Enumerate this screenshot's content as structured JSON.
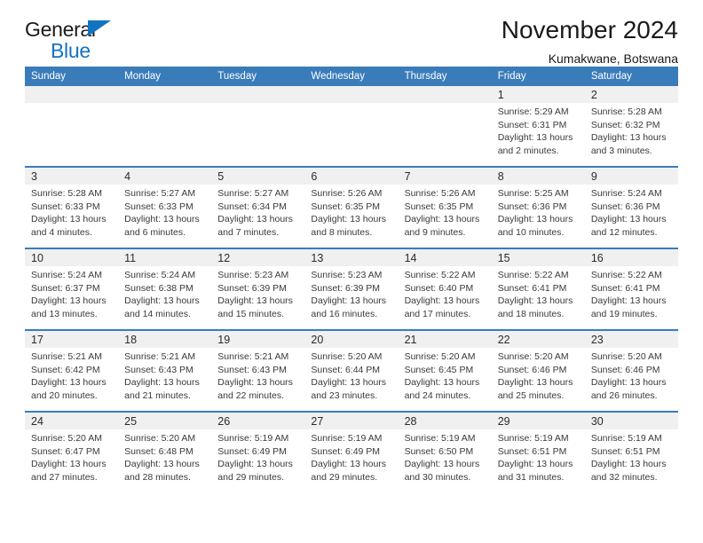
{
  "brand": {
    "name_top": "General",
    "name_bottom": "Blue",
    "triangle_color": "#1273c1"
  },
  "header": {
    "title": "November 2024",
    "subtitle": "Kumakwane, Botswana"
  },
  "theme": {
    "header_blue": "#3a7cba",
    "day_band_gray": "#f0f0f0",
    "text_dark": "#1a1a1a",
    "text_body": "#3a3a3a"
  },
  "calendar": {
    "weekdays": [
      "Sunday",
      "Monday",
      "Tuesday",
      "Wednesday",
      "Thursday",
      "Friday",
      "Saturday"
    ],
    "weeks": [
      [
        {
          "day": "",
          "lines": []
        },
        {
          "day": "",
          "lines": []
        },
        {
          "day": "",
          "lines": []
        },
        {
          "day": "",
          "lines": []
        },
        {
          "day": "",
          "lines": []
        },
        {
          "day": "1",
          "lines": [
            "Sunrise: 5:29 AM",
            "Sunset: 6:31 PM",
            "Daylight: 13 hours",
            "and 2 minutes."
          ]
        },
        {
          "day": "2",
          "lines": [
            "Sunrise: 5:28 AM",
            "Sunset: 6:32 PM",
            "Daylight: 13 hours",
            "and 3 minutes."
          ]
        }
      ],
      [
        {
          "day": "3",
          "lines": [
            "Sunrise: 5:28 AM",
            "Sunset: 6:33 PM",
            "Daylight: 13 hours",
            "and 4 minutes."
          ]
        },
        {
          "day": "4",
          "lines": [
            "Sunrise: 5:27 AM",
            "Sunset: 6:33 PM",
            "Daylight: 13 hours",
            "and 6 minutes."
          ]
        },
        {
          "day": "5",
          "lines": [
            "Sunrise: 5:27 AM",
            "Sunset: 6:34 PM",
            "Daylight: 13 hours",
            "and 7 minutes."
          ]
        },
        {
          "day": "6",
          "lines": [
            "Sunrise: 5:26 AM",
            "Sunset: 6:35 PM",
            "Daylight: 13 hours",
            "and 8 minutes."
          ]
        },
        {
          "day": "7",
          "lines": [
            "Sunrise: 5:26 AM",
            "Sunset: 6:35 PM",
            "Daylight: 13 hours",
            "and 9 minutes."
          ]
        },
        {
          "day": "8",
          "lines": [
            "Sunrise: 5:25 AM",
            "Sunset: 6:36 PM",
            "Daylight: 13 hours",
            "and 10 minutes."
          ]
        },
        {
          "day": "9",
          "lines": [
            "Sunrise: 5:24 AM",
            "Sunset: 6:36 PM",
            "Daylight: 13 hours",
            "and 12 minutes."
          ]
        }
      ],
      [
        {
          "day": "10",
          "lines": [
            "Sunrise: 5:24 AM",
            "Sunset: 6:37 PM",
            "Daylight: 13 hours",
            "and 13 minutes."
          ]
        },
        {
          "day": "11",
          "lines": [
            "Sunrise: 5:24 AM",
            "Sunset: 6:38 PM",
            "Daylight: 13 hours",
            "and 14 minutes."
          ]
        },
        {
          "day": "12",
          "lines": [
            "Sunrise: 5:23 AM",
            "Sunset: 6:39 PM",
            "Daylight: 13 hours",
            "and 15 minutes."
          ]
        },
        {
          "day": "13",
          "lines": [
            "Sunrise: 5:23 AM",
            "Sunset: 6:39 PM",
            "Daylight: 13 hours",
            "and 16 minutes."
          ]
        },
        {
          "day": "14",
          "lines": [
            "Sunrise: 5:22 AM",
            "Sunset: 6:40 PM",
            "Daylight: 13 hours",
            "and 17 minutes."
          ]
        },
        {
          "day": "15",
          "lines": [
            "Sunrise: 5:22 AM",
            "Sunset: 6:41 PM",
            "Daylight: 13 hours",
            "and 18 minutes."
          ]
        },
        {
          "day": "16",
          "lines": [
            "Sunrise: 5:22 AM",
            "Sunset: 6:41 PM",
            "Daylight: 13 hours",
            "and 19 minutes."
          ]
        }
      ],
      [
        {
          "day": "17",
          "lines": [
            "Sunrise: 5:21 AM",
            "Sunset: 6:42 PM",
            "Daylight: 13 hours",
            "and 20 minutes."
          ]
        },
        {
          "day": "18",
          "lines": [
            "Sunrise: 5:21 AM",
            "Sunset: 6:43 PM",
            "Daylight: 13 hours",
            "and 21 minutes."
          ]
        },
        {
          "day": "19",
          "lines": [
            "Sunrise: 5:21 AM",
            "Sunset: 6:43 PM",
            "Daylight: 13 hours",
            "and 22 minutes."
          ]
        },
        {
          "day": "20",
          "lines": [
            "Sunrise: 5:20 AM",
            "Sunset: 6:44 PM",
            "Daylight: 13 hours",
            "and 23 minutes."
          ]
        },
        {
          "day": "21",
          "lines": [
            "Sunrise: 5:20 AM",
            "Sunset: 6:45 PM",
            "Daylight: 13 hours",
            "and 24 minutes."
          ]
        },
        {
          "day": "22",
          "lines": [
            "Sunrise: 5:20 AM",
            "Sunset: 6:46 PM",
            "Daylight: 13 hours",
            "and 25 minutes."
          ]
        },
        {
          "day": "23",
          "lines": [
            "Sunrise: 5:20 AM",
            "Sunset: 6:46 PM",
            "Daylight: 13 hours",
            "and 26 minutes."
          ]
        }
      ],
      [
        {
          "day": "24",
          "lines": [
            "Sunrise: 5:20 AM",
            "Sunset: 6:47 PM",
            "Daylight: 13 hours",
            "and 27 minutes."
          ]
        },
        {
          "day": "25",
          "lines": [
            "Sunrise: 5:20 AM",
            "Sunset: 6:48 PM",
            "Daylight: 13 hours",
            "and 28 minutes."
          ]
        },
        {
          "day": "26",
          "lines": [
            "Sunrise: 5:19 AM",
            "Sunset: 6:49 PM",
            "Daylight: 13 hours",
            "and 29 minutes."
          ]
        },
        {
          "day": "27",
          "lines": [
            "Sunrise: 5:19 AM",
            "Sunset: 6:49 PM",
            "Daylight: 13 hours",
            "and 29 minutes."
          ]
        },
        {
          "day": "28",
          "lines": [
            "Sunrise: 5:19 AM",
            "Sunset: 6:50 PM",
            "Daylight: 13 hours",
            "and 30 minutes."
          ]
        },
        {
          "day": "29",
          "lines": [
            "Sunrise: 5:19 AM",
            "Sunset: 6:51 PM",
            "Daylight: 13 hours",
            "and 31 minutes."
          ]
        },
        {
          "day": "30",
          "lines": [
            "Sunrise: 5:19 AM",
            "Sunset: 6:51 PM",
            "Daylight: 13 hours",
            "and 32 minutes."
          ]
        }
      ]
    ]
  }
}
